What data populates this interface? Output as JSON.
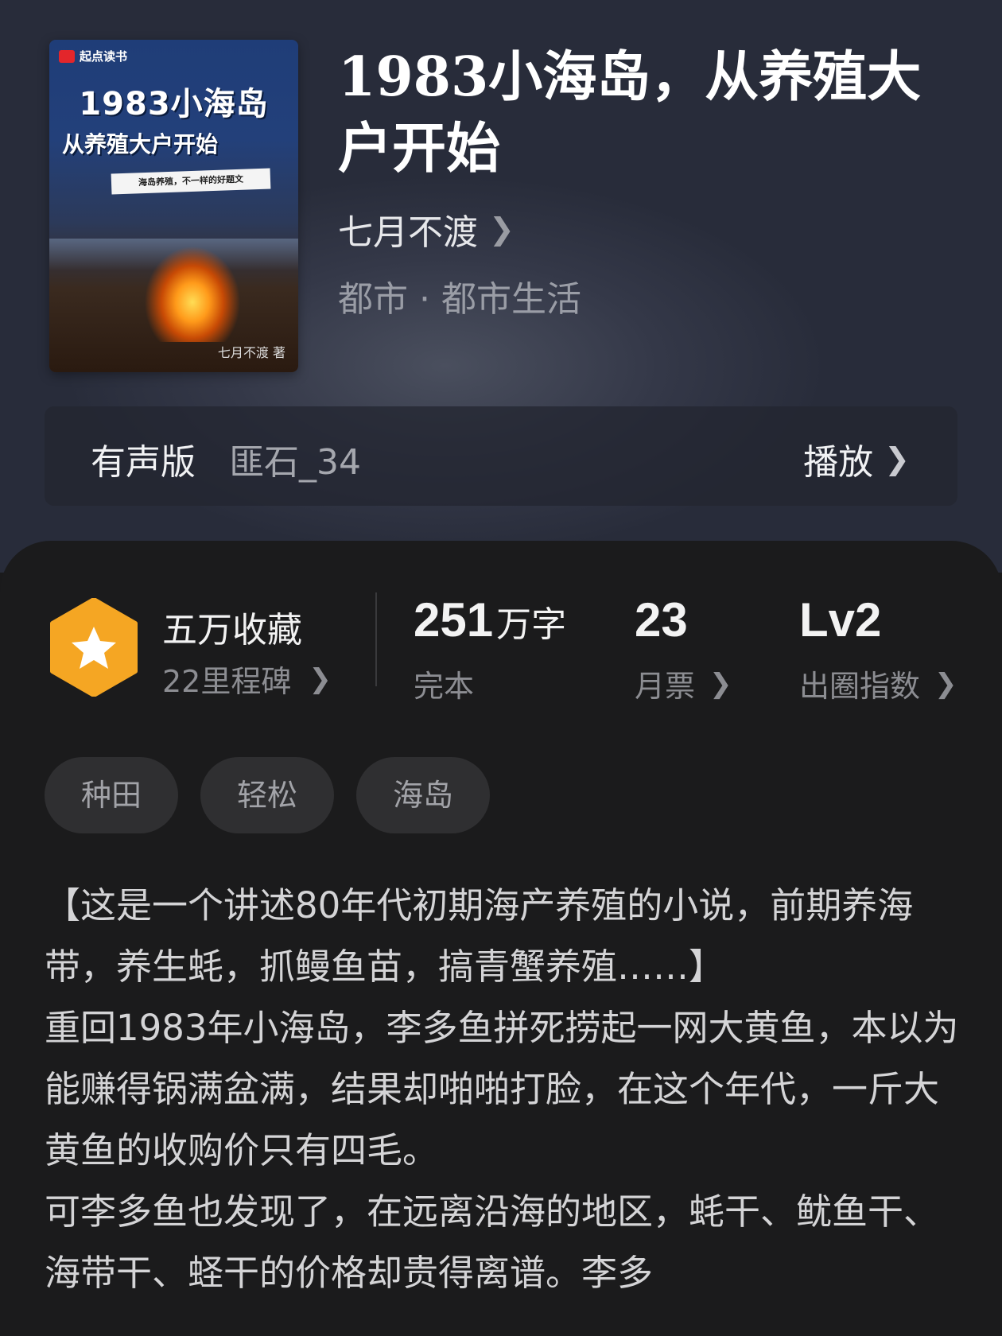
{
  "book": {
    "title": "1983小海岛，从养殖大户开始",
    "author": "七月不渡",
    "genre": "都市 · 都市生活"
  },
  "cover": {
    "brand": "起点读书",
    "title": "1983小海岛",
    "subtitle": "从养殖大户开始",
    "tagline": "海岛养殖，不一样的好题文",
    "author": "七月不渡 著"
  },
  "audio": {
    "label": "有声版",
    "narrator": "匪石_34",
    "play_label": "播放"
  },
  "stats": {
    "collect_title": "五万收藏",
    "milestone": "22里程碑",
    "words_value": "251",
    "words_unit": "万字",
    "words_status": "完本",
    "tickets_value": "23",
    "tickets_label": "月票",
    "level_value": "Lv2",
    "level_label": "出圈指数"
  },
  "tags": [
    "种田",
    "轻松",
    "海岛"
  ],
  "description": [
    "【这是一个讲述80年代初期海产养殖的小说，前期养海带，养生蚝，抓鳗鱼苗，搞青蟹养殖……】",
    "重回1983年小海岛，李多鱼拼死捞起一网大黄鱼，本以为能赚得锅满盆满，结果却啪啪打脸，在这个年代，一斤大黄鱼的收购价只有四毛。",
    "可李多鱼也发现了，在远离沿海的地区，蚝干、鱿鱼干、海带干、蛏干的价格却贵得离谱。李多"
  ],
  "colors": {
    "badge_orange": "#f5a623",
    "panel_bg": "#1b1b1c"
  }
}
